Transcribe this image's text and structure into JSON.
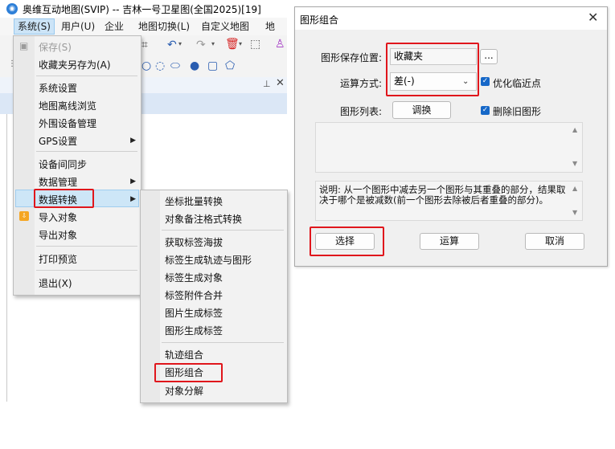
{
  "app": {
    "title": "奥维互动地图(SVIP) -- 吉林一号卫星图(全国2025)[19]",
    "menubar": [
      "系统(S)",
      "用户(U)",
      "企业",
      "地图切换(L)",
      "自定义地图",
      "地图"
    ]
  },
  "system_menu": {
    "items": [
      {
        "label": "保存(S)"
      },
      {
        "label": "收藏夹另存为(A)"
      },
      {
        "label": "系统设置"
      },
      {
        "label": "地图离线浏览"
      },
      {
        "label": "外围设备管理"
      },
      {
        "label": "GPS设置"
      },
      {
        "label": "设备间同步"
      },
      {
        "label": "数据管理"
      },
      {
        "label": "数据转换"
      },
      {
        "label": "导入对象"
      },
      {
        "label": "导出对象"
      },
      {
        "label": "打印预览"
      },
      {
        "label": "退出(X)"
      }
    ]
  },
  "convert_submenu": {
    "items": [
      {
        "label": "坐标批量转换"
      },
      {
        "label": "对象备注格式转换"
      },
      {
        "label": "获取标签海拔"
      },
      {
        "label": "标签生成轨迹与图形"
      },
      {
        "label": "标签生成对象"
      },
      {
        "label": "标签附件合并"
      },
      {
        "label": "图片生成标签"
      },
      {
        "label": "图形生成标签"
      },
      {
        "label": "轨迹组合"
      },
      {
        "label": "图形组合"
      },
      {
        "label": "对象分解"
      }
    ]
  },
  "dialog": {
    "title": "图形组合",
    "save_location_label": "图形保存位置:",
    "save_location_value": "收藏夹",
    "browse_label": "...",
    "operation_label": "运算方式:",
    "operation_value": "差(-)",
    "optimize_label": "优化临近点",
    "shape_list_label": "图形列表:",
    "swap_label": "调换",
    "delete_old_label": "删除旧图形",
    "description": "说明: 从一个图形中减去另一个图形与其重叠的部分，结果取决于哪个是被减数(前一个图形去除被后者重叠的部分)。",
    "select_label": "选择",
    "compute_label": "运算",
    "cancel_label": "取消",
    "accent_color": "#1668c8"
  },
  "highlight_color": "#e0161c"
}
